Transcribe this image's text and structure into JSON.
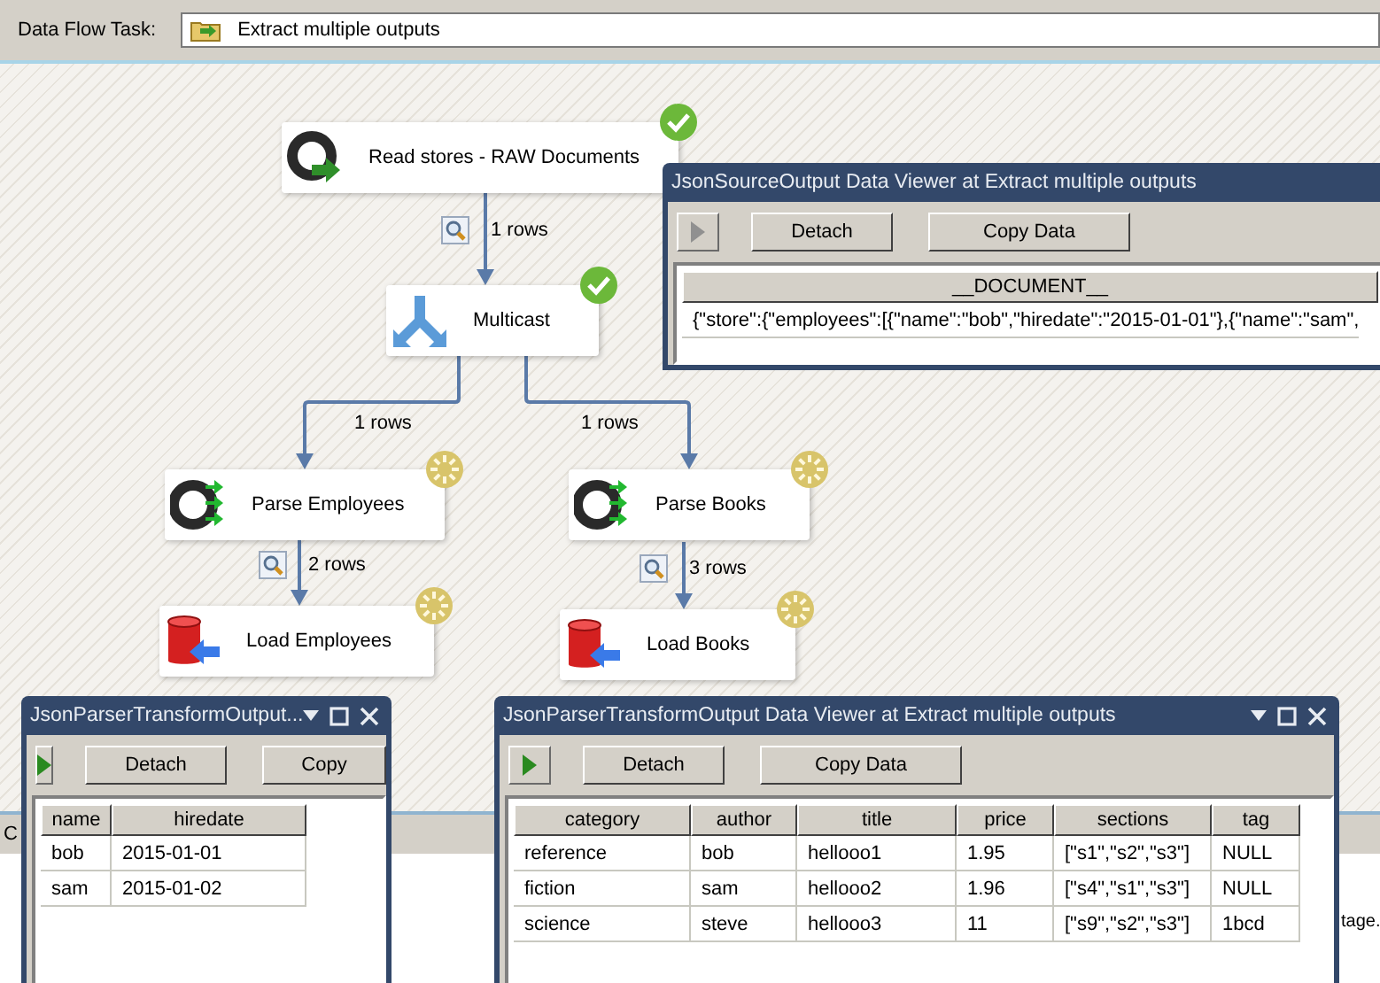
{
  "toolbar": {
    "label": "Data Flow Task:",
    "task": "Extract multiple outputs"
  },
  "nodes": [
    {
      "label": "Read stores - RAW Documents",
      "kind": "source",
      "completed": true
    },
    {
      "label": "Multicast",
      "kind": "multicast",
      "completed": true
    },
    {
      "label": "Parse Employees",
      "kind": "parser",
      "completed": false
    },
    {
      "label": "Parse Books",
      "kind": "parser",
      "completed": false
    },
    {
      "label": "Load Employees",
      "kind": "destination",
      "completed": false
    },
    {
      "label": "Load Books",
      "kind": "destination",
      "completed": false
    }
  ],
  "paths": [
    {
      "label": "1 rows",
      "viewer": true
    },
    {
      "label": "1 rows",
      "viewer": false
    },
    {
      "label": "1 rows",
      "viewer": false
    },
    {
      "label": "2 rows",
      "viewer": true
    },
    {
      "label": "3 rows",
      "viewer": true
    }
  ],
  "background_panel": {
    "tab": "C",
    "text": "tage."
  },
  "viewers": [
    {
      "title": "JsonSourceOutput Data Viewer at Extract multiple outputs",
      "running": false,
      "controls": false,
      "buttons": [
        "Detach",
        "Copy Data"
      ],
      "columns": [
        "__DOCUMENT__"
      ],
      "rows": [
        [
          "{\"store\":{\"employees\":[{\"name\":\"bob\",\"hiredate\":\"2015-01-01\"},{\"name\":\"sam\","
        ]
      ]
    },
    {
      "title": "JsonParserTransformOutput...",
      "running": true,
      "controls": true,
      "buttons": [
        "Detach",
        "Copy"
      ],
      "columns": [
        "name",
        "hiredate"
      ],
      "rows": [
        [
          "bob",
          "2015-01-01"
        ],
        [
          "sam",
          "2015-01-02"
        ]
      ]
    },
    {
      "title": "JsonParserTransformOutput Data Viewer at Extract multiple outputs",
      "running": true,
      "controls": true,
      "buttons": [
        "Detach",
        "Copy Data"
      ],
      "columns": [
        "category",
        "author",
        "title",
        "price",
        "sections",
        "tag"
      ],
      "rows": [
        [
          "reference",
          "bob",
          "hellooo1",
          "1.95",
          "[\"s1\",\"s2\",\"s3\"]",
          "NULL"
        ],
        [
          "fiction",
          "sam",
          "hellooo2",
          "1.96",
          "[\"s4\",\"s1\",\"s3\"]",
          "NULL"
        ],
        [
          "science",
          "steve",
          "hellooo3",
          "11",
          "[\"s9\",\"s2\",\"s3\"]",
          "1bcd"
        ]
      ]
    }
  ]
}
